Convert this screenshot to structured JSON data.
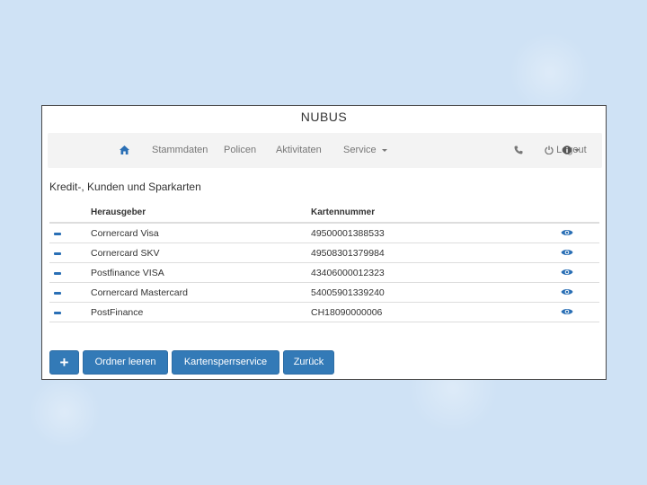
{
  "app": {
    "title": "NUBUS"
  },
  "nav": {
    "home_icon": "home-icon",
    "items": [
      "Stammdaten",
      "Policen",
      "Aktivitaten",
      "Service"
    ],
    "phone_icon": "phone-icon",
    "logout_label": "Logout",
    "info_icon": "info-icon"
  },
  "section": {
    "heading": "Kredit-, Kunden und Sparkarten"
  },
  "table": {
    "columns": [
      "Herausgeber",
      "Kartennummer"
    ],
    "rows": [
      {
        "issuer": "Cornercard Visa",
        "number": "49500001388533"
      },
      {
        "issuer": "Cornercard SKV",
        "number": "49508301379984"
      },
      {
        "issuer": "Postfinance VISA",
        "number": "43406000012323"
      },
      {
        "issuer": "Cornercard Mastercard",
        "number": "54005901339240"
      },
      {
        "issuer": "PostFinance",
        "number": "CH18090000006"
      }
    ]
  },
  "buttons": {
    "add": "+",
    "clear_folder": "Ordner leeren",
    "card_block_service": "Kartensperrservice",
    "back": "Zurück"
  },
  "colors": {
    "primary": "#337ab7",
    "navbar_bg": "#f3f3f3",
    "page_bg": "#cfe2f5"
  }
}
